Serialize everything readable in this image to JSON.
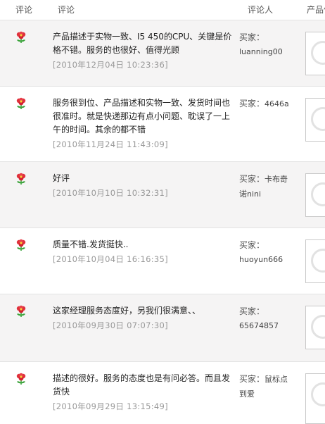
{
  "header": {
    "col_rating": "评论",
    "col_comment": "评论",
    "col_reviewer": "评论人",
    "col_product": "产品信息"
  },
  "reviews": [
    {
      "rating_icon": "red-flower-icon",
      "text": "产品描述于实物一致、I5 450的CPU、关键是价格不错。服务的也很好、值得光顾",
      "date": "[2010年12月04日 10:23:36]",
      "buyer_prefix": "买家：",
      "buyer_name": "luanning00"
    },
    {
      "rating_icon": "red-flower-icon",
      "text": "服务很到位、产品描述和实物一致、发货时间也很准时。就是快递那边有点小问题、耽误了一上午的时间。其余的都不错",
      "date": "[2010年11月24日 11:43:09]",
      "buyer_prefix": "买家：",
      "buyer_name": "4646a"
    },
    {
      "rating_icon": "red-flower-icon",
      "text": "好评",
      "date": "[2010年10月10日 10:32:31]",
      "buyer_prefix": "买家：",
      "buyer_name": "卡布奇诺nini"
    },
    {
      "rating_icon": "red-flower-icon",
      "text": "质量不错.发货挺快..",
      "date": "[2010年10月04日 16:16:35]",
      "buyer_prefix": "买家：",
      "buyer_name": "huoyun666"
    },
    {
      "rating_icon": "red-flower-icon",
      "text": "这家经理服务态度好，另我们很满意、、",
      "date": "[2010年09月30日 07:07:30]",
      "buyer_prefix": "买家：",
      "buyer_name": "65674857"
    },
    {
      "rating_icon": "red-flower-icon",
      "text": "描述的很好。服务的态度也是有问必答。而且发货快",
      "date": "[2010年09月29日 13:15:49]",
      "buyer_prefix": "买家：",
      "buyer_name": "鼠标点到爱"
    }
  ],
  "colors": {
    "alt_row_bg": "#f5f4f4",
    "date_text": "#999999",
    "flower_red": "#e0303c",
    "leaf_green": "#3aa33a"
  }
}
